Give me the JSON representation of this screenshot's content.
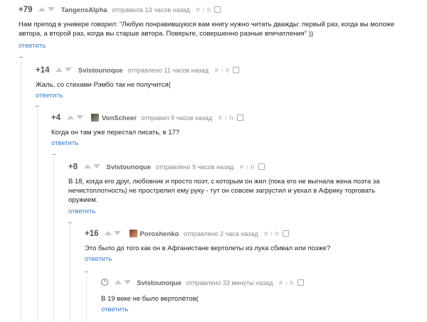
{
  "reply_label": "ответить",
  "comments": [
    {
      "rating": "+79",
      "author": "TangensAlpha",
      "time": "отправила 13 часов назад",
      "text": "Нам препод в универе говорил: \"Любую понравившуюся вам книгу нужно читать дважды: первый раз, когда вы моложе автора, а второй раз, когда вы старше автора. Поверьте, совершенно разные впечатления\" ))"
    },
    {
      "rating": "+14",
      "author": "Svistounoque",
      "time": "отправлено 11 часов назад",
      "text": "Жаль, со стихами Рэмбо так не получится("
    },
    {
      "rating": "+4",
      "author": "VonScheer",
      "time": "отправил 9 часов назад",
      "text": "Когда он там уже перестал писать, в 17?"
    },
    {
      "rating": "+8",
      "author": "Svistounoque",
      "time": "отправлено 9 часов назад",
      "text": "В 18, когда его друг, любовник и просто поэт, с которым он жил (пока его не выгнала жена поэта за нечистоплотность) не прострелил ему руку - тут он совсем загрустил и уехал в Африку торговать оружием."
    },
    {
      "rating": "+16",
      "author": "Poroshenko",
      "time": "отправлено 2 часа назад",
      "text": "Это было до того как он в Афганистане вертолеты из лука сбивал или позже?"
    },
    {
      "rating": "",
      "author": "Svistounoque",
      "time": "отправлено 33 минуты назад",
      "text": "В 19 веке не было вертолётов("
    }
  ]
}
